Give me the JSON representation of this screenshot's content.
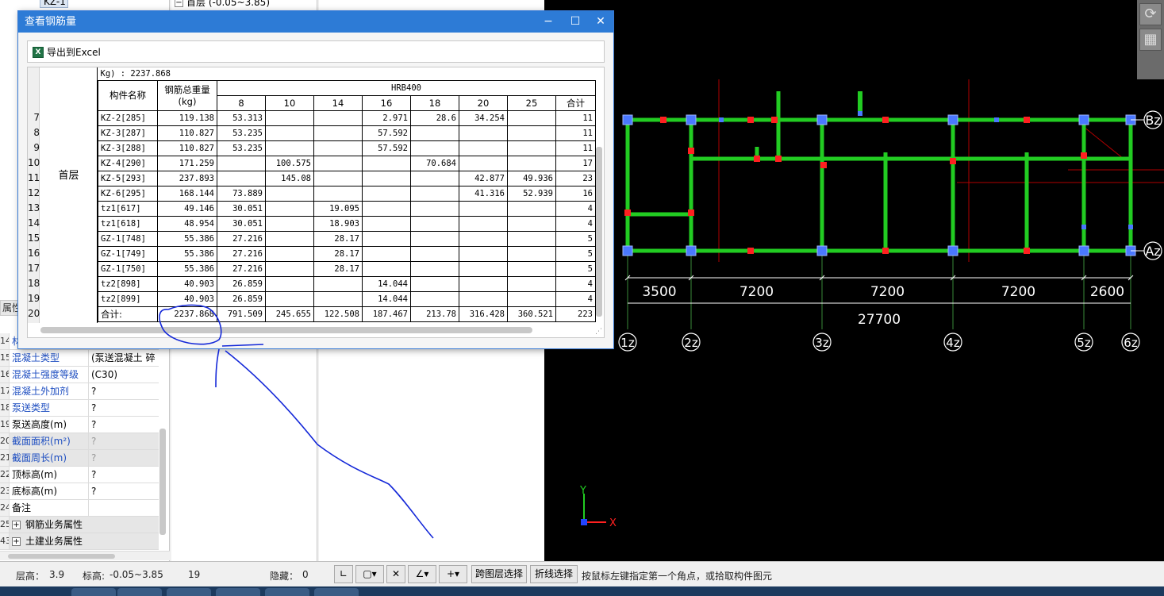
{
  "tree": {
    "tab_label": "KZ-1",
    "floor_node": "首层 (-0.05~3.85)",
    "collapse_symbol": "−"
  },
  "properties": {
    "header": "属性",
    "rows": [
      {
        "num": "14",
        "name": "材",
        "value": "",
        "style": "blue"
      },
      {
        "num": "15",
        "name": "混凝土类型",
        "value": "(泵送混凝土 碎",
        "style": "blue"
      },
      {
        "num": "16",
        "name": "混凝土强度等级",
        "value": "(C30)",
        "style": "blue"
      },
      {
        "num": "17",
        "name": "混凝土外加剂",
        "value": "?",
        "style": "blue"
      },
      {
        "num": "18",
        "name": "泵送类型",
        "value": "?",
        "style": "blue"
      },
      {
        "num": "19",
        "name": "泵送高度(m)",
        "value": "?",
        "style": "plain"
      },
      {
        "num": "20",
        "name": "截面面积(m²)",
        "value": "?",
        "style": "shade"
      },
      {
        "num": "21",
        "name": "截面周长(m)",
        "value": "?",
        "style": "shade"
      },
      {
        "num": "22",
        "name": "顶标高(m)",
        "value": "?",
        "style": "plain"
      },
      {
        "num": "23",
        "name": "底标高(m)",
        "value": "?",
        "style": "plain"
      },
      {
        "num": "24",
        "name": "备注",
        "value": "",
        "style": "plain"
      },
      {
        "num": "25",
        "name": "钢筋业务属性",
        "value": "",
        "style": "group"
      },
      {
        "num": "43",
        "name": "土建业务属性",
        "value": "",
        "style": "group"
      }
    ]
  },
  "dialog": {
    "title": "查看钢筋量",
    "controls": {
      "minimize": "−",
      "maximize": "☐",
      "close": "✕"
    },
    "export_label": "导出到Excel",
    "summary_line": "Kg) : 2237.868",
    "headers": {
      "component": "构件名称",
      "total_line1": "钢筋总重量",
      "total_line2": "(kg)",
      "grade": "HRB400",
      "diameters": [
        "8",
        "10",
        "14",
        "16",
        "18",
        "20",
        "25",
        "合计"
      ]
    },
    "floor_label": "首层",
    "row_numbers": [
      "7",
      "8",
      "9",
      "10",
      "11",
      "12",
      "13",
      "14",
      "15",
      "16",
      "17",
      "18",
      "19",
      "20"
    ],
    "rows": [
      {
        "name": "KZ-2[285]",
        "total": "119.138",
        "cells": [
          "53.313",
          "",
          "",
          "2.971",
          "28.6",
          "34.254",
          "",
          "11"
        ]
      },
      {
        "name": "KZ-3[287]",
        "total": "110.827",
        "cells": [
          "53.235",
          "",
          "",
          "57.592",
          "",
          "",
          "",
          "11"
        ]
      },
      {
        "name": "KZ-3[288]",
        "total": "110.827",
        "cells": [
          "53.235",
          "",
          "",
          "57.592",
          "",
          "",
          "",
          "11"
        ]
      },
      {
        "name": "KZ-4[290]",
        "total": "171.259",
        "cells": [
          "",
          "100.575",
          "",
          "",
          "70.684",
          "",
          "",
          "17"
        ]
      },
      {
        "name": "KZ-5[293]",
        "total": "237.893",
        "cells": [
          "",
          "145.08",
          "",
          "",
          "",
          "42.877",
          "49.936",
          "23"
        ]
      },
      {
        "name": "KZ-6[295]",
        "total": "168.144",
        "cells": [
          "73.889",
          "",
          "",
          "",
          "",
          "41.316",
          "52.939",
          "16"
        ]
      },
      {
        "name": "tz1[617]",
        "total": "49.146",
        "cells": [
          "30.051",
          "",
          "19.095",
          "",
          "",
          "",
          "",
          "4"
        ]
      },
      {
        "name": "tz1[618]",
        "total": "48.954",
        "cells": [
          "30.051",
          "",
          "18.903",
          "",
          "",
          "",
          "",
          "4"
        ]
      },
      {
        "name": "GZ-1[748]",
        "total": "55.386",
        "cells": [
          "27.216",
          "",
          "28.17",
          "",
          "",
          "",
          "",
          "5"
        ]
      },
      {
        "name": "GZ-1[749]",
        "total": "55.386",
        "cells": [
          "27.216",
          "",
          "28.17",
          "",
          "",
          "",
          "",
          "5"
        ]
      },
      {
        "name": "GZ-1[750]",
        "total": "55.386",
        "cells": [
          "27.216",
          "",
          "28.17",
          "",
          "",
          "",
          "",
          "5"
        ]
      },
      {
        "name": "tz2[898]",
        "total": "40.903",
        "cells": [
          "26.859",
          "",
          "",
          "14.044",
          "",
          "",
          "",
          "4"
        ]
      },
      {
        "name": "tz2[899]",
        "total": "40.903",
        "cells": [
          "26.859",
          "",
          "",
          "14.044",
          "",
          "",
          "",
          "4"
        ]
      }
    ],
    "totals_row": {
      "name": "合计:",
      "total": "2237.868",
      "cells": [
        "791.509",
        "245.655",
        "122.508",
        "187.467",
        "213.78",
        "316.428",
        "360.521",
        "223"
      ]
    }
  },
  "cad": {
    "axis_top": "Bz",
    "axis_bottom": "Az",
    "spans": [
      "3500",
      "7200",
      "7200",
      "7200",
      "2600"
    ],
    "total_span": "27700",
    "grid_labels": [
      "1z",
      "2z",
      "3z",
      "4z",
      "5z",
      "6z"
    ],
    "ucs_x": "X",
    "ucs_y": "Y",
    "colors": {
      "beam": "#22cc22",
      "column": "#4a78ff",
      "axis": "#ffffff",
      "mark": "#ff2020"
    }
  },
  "status": {
    "floor_height_label": "层高：",
    "floor_height": "3.9",
    "elevation_label": "标高:",
    "elevation": "-0.05~3.85",
    "count": "19",
    "hidden_label": "隐藏：",
    "hidden": "0",
    "btn_cross_layer": "跨图层选择",
    "btn_polyline": "折线选择",
    "hint": "按鼠标左键指定第一个角点，或拾取构件图元"
  }
}
